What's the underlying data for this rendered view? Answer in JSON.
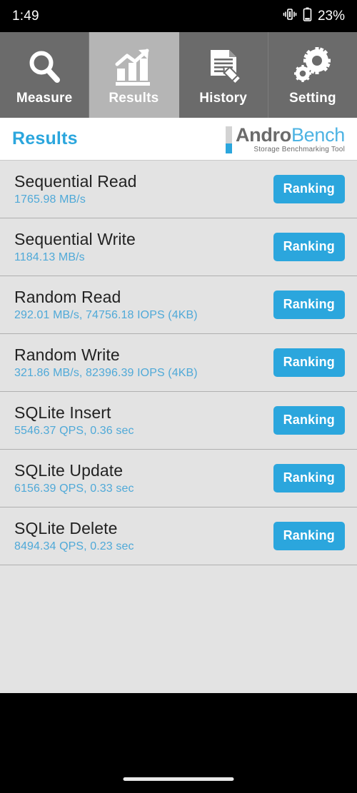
{
  "statusbar": {
    "time": "1:49",
    "vibrate_icon": "vibrate-icon",
    "battery_icon": "battery-icon",
    "battery_percent": "23%"
  },
  "tabs": [
    {
      "label": "Measure",
      "icon": "magnifier-icon",
      "selected": false
    },
    {
      "label": "Results",
      "icon": "bar-chart-arrow-icon",
      "selected": true
    },
    {
      "label": "History",
      "icon": "document-pencil-icon",
      "selected": false
    },
    {
      "label": "Setting",
      "icon": "gears-icon",
      "selected": false
    }
  ],
  "header": {
    "title": "Results",
    "logo": {
      "name_part1": "Andro",
      "name_part2": "Bench",
      "tagline": "Storage Benchmarking Tool"
    }
  },
  "results": [
    {
      "name": "Sequential Read",
      "value": "1765.98 MB/s",
      "button": "Ranking"
    },
    {
      "name": "Sequential Write",
      "value": "1184.13 MB/s",
      "button": "Ranking"
    },
    {
      "name": "Random Read",
      "value": "292.01 MB/s, 74756.18 IOPS (4KB)",
      "button": "Ranking"
    },
    {
      "name": "Random Write",
      "value": "321.86 MB/s, 82396.39 IOPS (4KB)",
      "button": "Ranking"
    },
    {
      "name": "SQLite Insert",
      "value": "5546.37 QPS, 0.36 sec",
      "button": "Ranking"
    },
    {
      "name": "SQLite Update",
      "value": "6156.39 QPS, 0.33 sec",
      "button": "Ranking"
    },
    {
      "name": "SQLite Delete",
      "value": "8494.34 QPS, 0.23 sec",
      "button": "Ranking"
    }
  ],
  "colors": {
    "accent_blue": "#2ba6dd",
    "value_blue": "#4fa9d8",
    "tab_bg": "#6b6b6b",
    "tab_selected_bg": "#b5b5b5",
    "list_bg": "#e3e3e3",
    "statusbar_bg": "#000000"
  },
  "navbar": {
    "home_indicator": "home-indicator"
  }
}
